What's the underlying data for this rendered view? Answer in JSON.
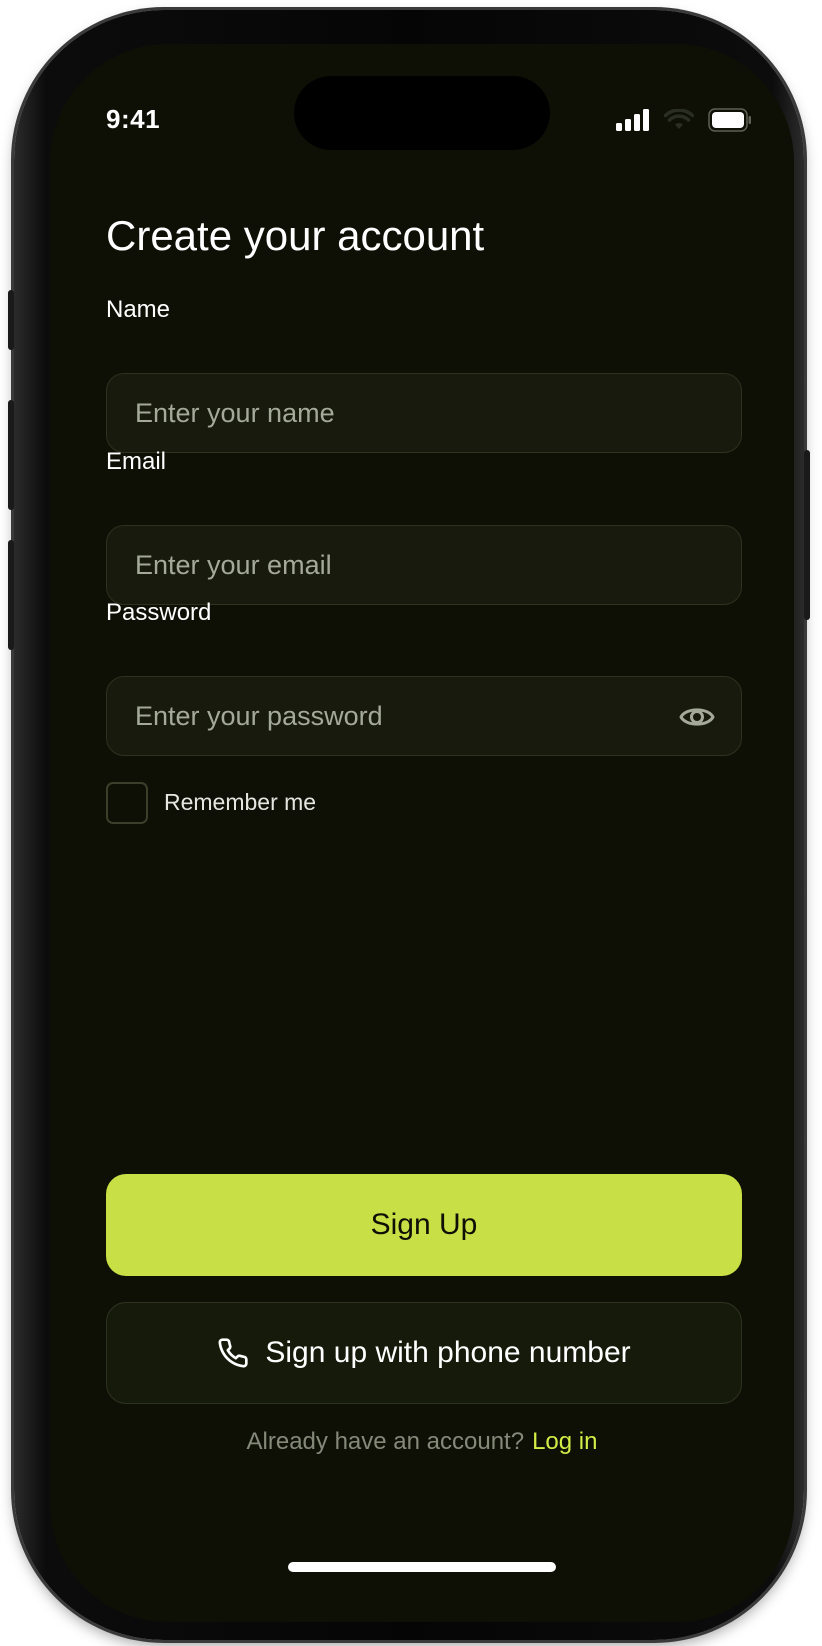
{
  "status_bar": {
    "time": "9:41",
    "icons": [
      "cellular-signal-icon",
      "wifi-icon",
      "battery-icon"
    ]
  },
  "page": {
    "title": "Create your account"
  },
  "form": {
    "name": {
      "label": "Name",
      "placeholder": "Enter your name",
      "value": ""
    },
    "email": {
      "label": "Email",
      "placeholder": "Enter your email",
      "value": ""
    },
    "password": {
      "label": "Password",
      "placeholder": "Enter your password",
      "value": "",
      "toggle_icon": "eye-icon"
    },
    "remember": {
      "label": "Remember me",
      "checked": false
    }
  },
  "actions": {
    "signup_label": "Sign Up",
    "phone_signup_label": "Sign up with phone number",
    "phone_icon": "phone-icon"
  },
  "footer": {
    "prompt": "Already have an account?",
    "login_label": "Log in"
  },
  "colors": {
    "background": "#0e1006",
    "accent": "#c8df45",
    "input_bg": "#171a0c",
    "link": "#d3ec46"
  }
}
